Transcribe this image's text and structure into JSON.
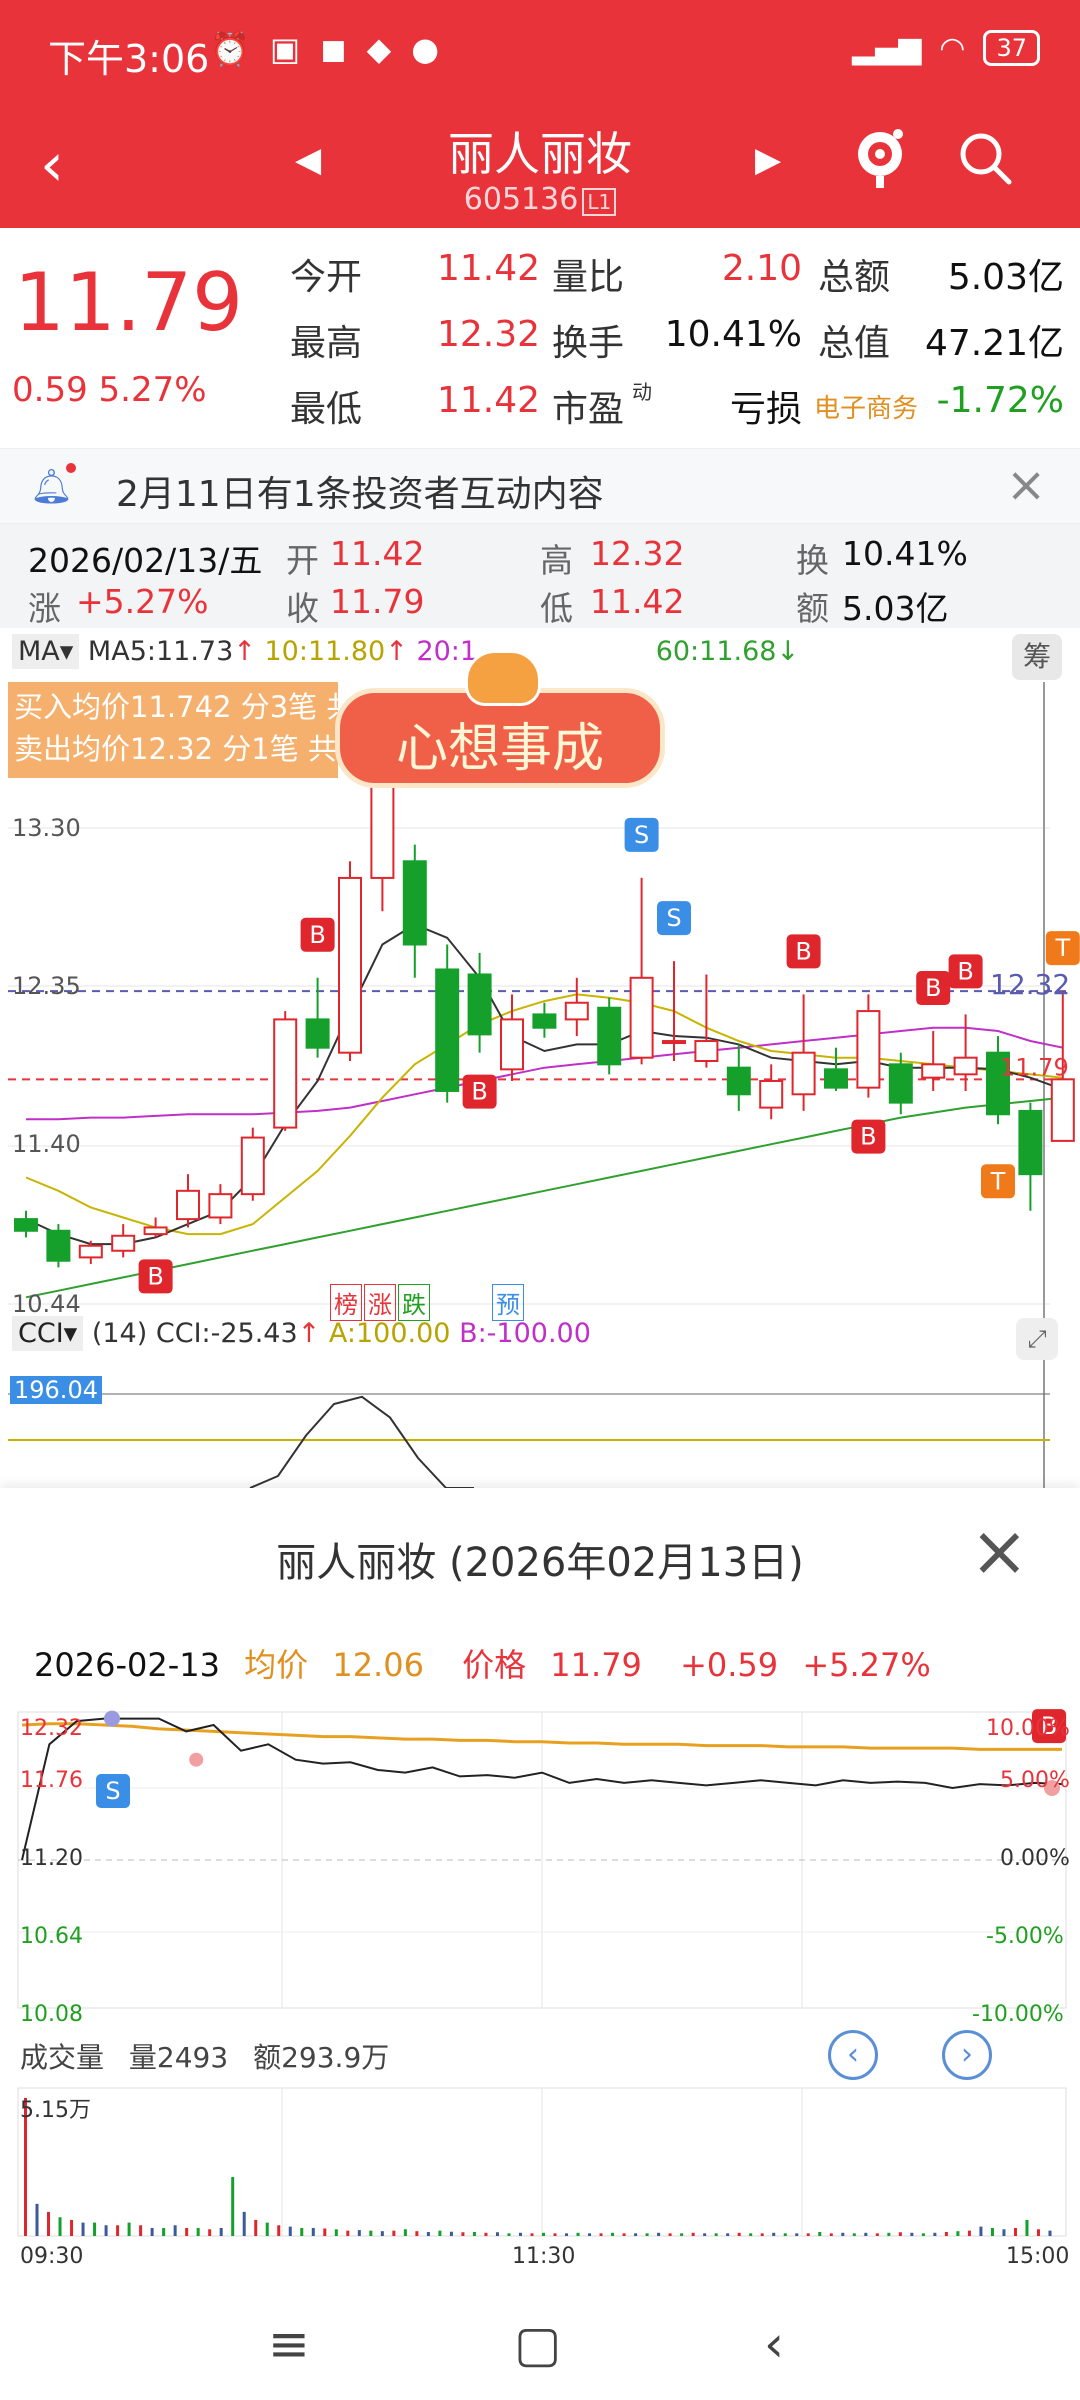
{
  "status_bar": {
    "time": "下午3:06",
    "icons_left": [
      "alarm-icon",
      "nfc-icon",
      "app-icon",
      "app-icon",
      "app-icon"
    ],
    "battery": "37"
  },
  "header": {
    "title": "丽人丽妆",
    "code": "605136",
    "code_badge": "L1"
  },
  "quote": {
    "price": "11.79",
    "change": "0.59",
    "change_pct": "5.27%",
    "fields": [
      {
        "label": "今开",
        "value": "11.42",
        "color": "#e8333a"
      },
      {
        "label": "量比",
        "value": "2.10",
        "color": "#e8333a"
      },
      {
        "label": "总额",
        "value": "5.03亿",
        "color": "#111111"
      },
      {
        "label": "最高",
        "value": "12.32",
        "color": "#e8333a"
      },
      {
        "label": "换手",
        "value": "10.41%",
        "color": "#111111"
      },
      {
        "label": "总值",
        "value": "47.21亿",
        "color": "#111111"
      },
      {
        "label": "最低",
        "value": "11.42",
        "color": "#e8333a"
      },
      {
        "label": "市盈",
        "value": "亏损",
        "color": "#111111"
      },
      {
        "label": "电子商务",
        "value": "-1.72%",
        "color": "#20a020"
      }
    ],
    "pe_superscript": "动"
  },
  "notice": {
    "text": "2月11日有1条投资者互动内容"
  },
  "kline_info": {
    "date": "2026/02/13/五",
    "open_label": "开",
    "open": "11.42",
    "high_label": "高",
    "high": "12.32",
    "turnover_label": "换",
    "turnover": "10.41%",
    "rise_label": "涨",
    "rise": "+5.27%",
    "close_label": "收",
    "close": "11.79",
    "low_label": "低",
    "low": "11.42",
    "amount_label": "额",
    "amount": "5.03亿"
  },
  "kline_chart": {
    "indicator": "MA",
    "ma5": "MA5:11.73",
    "ma10": "10:11.80",
    "ma20": "20:1",
    "ma60": "60:11.68",
    "chou_label": "筹",
    "buy_text": "买入均价11.742 分3笔 共",
    "sell_text": "卖出均价12.32 分1笔 共",
    "sticker_text": "心想事成",
    "y_ticks": [
      "13.30",
      "12.35",
      "11.40",
      "10.44"
    ],
    "price_line_label": "12.32",
    "current_label": "11.79",
    "tags": [
      "榜",
      "涨",
      "跌",
      "预"
    ],
    "cci_indicator": "CCI",
    "cci_params": "(14)",
    "cci_value": "CCI:-25.43",
    "cci_a": "A:100.00",
    "cci_b": "B:-100.00",
    "cci_top_label": "196.04",
    "candles": [
      {
        "o": 10.95,
        "c": 10.88,
        "h": 11.0,
        "l": 10.84
      },
      {
        "o": 10.88,
        "c": 10.7,
        "h": 10.92,
        "l": 10.66
      },
      {
        "o": 10.72,
        "c": 10.79,
        "h": 10.82,
        "l": 10.68
      },
      {
        "o": 10.76,
        "c": 10.85,
        "h": 10.92,
        "l": 10.72
      },
      {
        "o": 10.86,
        "c": 10.9,
        "h": 10.96,
        "l": 10.84
      },
      {
        "o": 10.95,
        "c": 11.12,
        "h": 11.22,
        "l": 10.9
      },
      {
        "o": 10.96,
        "c": 11.1,
        "h": 11.16,
        "l": 10.92
      },
      {
        "o": 11.1,
        "c": 11.44,
        "h": 11.5,
        "l": 11.06
      },
      {
        "o": 11.5,
        "c": 12.15,
        "h": 12.2,
        "l": 11.48
      },
      {
        "o": 12.15,
        "c": 11.98,
        "h": 12.4,
        "l": 11.92
      },
      {
        "o": 11.95,
        "c": 13.0,
        "h": 13.1,
        "l": 11.9
      },
      {
        "o": 13.0,
        "c": 13.62,
        "h": 13.7,
        "l": 12.8
      },
      {
        "o": 13.1,
        "c": 12.6,
        "h": 13.2,
        "l": 12.4
      },
      {
        "o": 12.45,
        "c": 11.72,
        "h": 12.6,
        "l": 11.65
      },
      {
        "o": 12.42,
        "c": 12.06,
        "h": 12.55,
        "l": 11.95
      },
      {
        "o": 11.85,
        "c": 12.15,
        "h": 12.3,
        "l": 11.78
      },
      {
        "o": 12.18,
        "c": 12.1,
        "h": 12.25,
        "l": 12.04
      },
      {
        "o": 12.15,
        "c": 12.25,
        "h": 12.4,
        "l": 12.05
      },
      {
        "o": 12.22,
        "c": 11.88,
        "h": 12.28,
        "l": 11.82
      },
      {
        "o": 11.92,
        "c": 12.4,
        "h": 13.0,
        "l": 11.88
      },
      {
        "o": 12.02,
        "c": 12.02,
        "h": 12.5,
        "l": 11.9
      },
      {
        "o": 11.9,
        "c": 12.02,
        "h": 12.42,
        "l": 11.86
      },
      {
        "o": 11.86,
        "c": 11.7,
        "h": 12.0,
        "l": 11.6
      },
      {
        "o": 11.62,
        "c": 11.78,
        "h": 11.88,
        "l": 11.55
      },
      {
        "o": 11.7,
        "c": 11.95,
        "h": 12.3,
        "l": 11.6
      },
      {
        "o": 11.85,
        "c": 11.74,
        "h": 11.98,
        "l": 11.72
      },
      {
        "o": 11.74,
        "c": 12.2,
        "h": 12.3,
        "l": 11.68
      },
      {
        "o": 11.88,
        "c": 11.65,
        "h": 11.95,
        "l": 11.58
      },
      {
        "o": 11.8,
        "c": 11.88,
        "h": 12.08,
        "l": 11.72
      },
      {
        "o": 11.82,
        "c": 11.92,
        "h": 12.18,
        "l": 11.72
      },
      {
        "o": 11.95,
        "c": 11.58,
        "h": 12.05,
        "l": 11.52
      },
      {
        "o": 11.6,
        "c": 11.22,
        "h": 11.65,
        "l": 11.0
      },
      {
        "o": 11.42,
        "c": 11.79,
        "h": 12.32,
        "l": 11.42
      }
    ],
    "ma5_line": [
      10.95,
      10.86,
      10.8,
      10.8,
      10.84,
      10.92,
      11.0,
      11.2,
      11.52,
      11.78,
      12.2,
      12.6,
      12.72,
      12.64,
      12.4,
      12.05,
      11.96,
      12.0,
      12.0,
      12.08,
      12.05,
      12.04,
      12.0,
      11.92,
      11.9,
      11.88,
      11.9,
      11.86,
      11.86,
      11.86,
      11.85,
      11.8,
      11.73
    ],
    "ma10_line": [
      11.2,
      11.12,
      11.02,
      10.96,
      10.9,
      10.86,
      10.86,
      10.92,
      11.08,
      11.24,
      11.45,
      11.68,
      11.88,
      12.0,
      12.12,
      12.2,
      12.26,
      12.3,
      12.28,
      12.25,
      12.2,
      12.1,
      12.02,
      11.96,
      11.94,
      11.92,
      11.92,
      11.9,
      11.88,
      11.86,
      11.84,
      11.82,
      11.8
    ],
    "ma20_line": [
      11.55,
      11.55,
      11.56,
      11.56,
      11.57,
      11.58,
      11.58,
      11.58,
      11.59,
      11.6,
      11.62,
      11.66,
      11.7,
      11.74,
      11.78,
      11.82,
      11.86,
      11.88,
      11.9,
      11.92,
      11.94,
      11.96,
      11.98,
      12.0,
      12.02,
      12.04,
      12.06,
      12.08,
      12.1,
      12.1,
      12.08,
      12.02,
      11.98
    ],
    "ma60_line": [
      10.48,
      10.52,
      10.56,
      10.6,
      10.64,
      10.68,
      10.72,
      10.76,
      10.8,
      10.84,
      10.88,
      10.92,
      10.96,
      11.0,
      11.04,
      11.08,
      11.12,
      11.16,
      11.2,
      11.24,
      11.28,
      11.32,
      11.36,
      11.4,
      11.44,
      11.48,
      11.52,
      11.56,
      11.59,
      11.62,
      11.64,
      11.66,
      11.68
    ],
    "cci_line": [
      -40,
      20,
      110,
      180,
      196,
      150,
      60,
      -10,
      -20
    ],
    "markers": [
      {
        "type": "b",
        "label": "B",
        "idx": 4
      },
      {
        "type": "b",
        "label": "B",
        "idx": 9
      },
      {
        "type": "s",
        "label": "S",
        "idx": 11
      },
      {
        "type": "b",
        "label": "B",
        "idx": 14
      },
      {
        "type": "s",
        "label": "S",
        "idx": 19
      },
      {
        "type": "s",
        "label": "S",
        "idx": 20
      },
      {
        "type": "b",
        "label": "B",
        "idx": 24
      },
      {
        "type": "b",
        "label": "B",
        "idx": 26
      },
      {
        "type": "b",
        "label": "B",
        "idx": 28
      },
      {
        "type": "b",
        "label": "B",
        "idx": 29
      },
      {
        "type": "t",
        "label": "T",
        "idx": 30
      },
      {
        "type": "t",
        "label": "T",
        "idx": 32
      }
    ]
  },
  "intraday": {
    "title": "丽人丽妆 (2026年02月13日)",
    "date": "2026-02-13",
    "avg_label": "均价",
    "avg": "12.06",
    "price_label": "价格",
    "price": "11.79",
    "change": "+0.59",
    "change_pct": "+5.27%",
    "y_left": [
      "12.32",
      "11.76",
      "11.20",
      "10.64",
      "10.08"
    ],
    "y_right": [
      "10.00%",
      "5.00%",
      "0.00%",
      "-5.00%",
      "-10.00%"
    ],
    "volume_label": "成交量",
    "volume": "量2493",
    "amount": "额293.9万",
    "vol_max_label": "5.15万",
    "x_labels": [
      "09:30",
      "11:30",
      "15:00"
    ],
    "price_series": [
      11.2,
      12.1,
      12.28,
      12.3,
      12.3,
      12.3,
      12.2,
      12.25,
      12.05,
      12.1,
      11.98,
      11.95,
      11.96,
      11.9,
      11.88,
      11.92,
      11.85,
      11.86,
      11.84,
      11.88,
      11.8,
      11.83,
      11.8,
      11.82,
      11.8,
      11.78,
      11.8,
      11.82,
      11.8,
      11.78,
      11.82,
      11.8,
      11.81,
      11.8,
      11.76,
      11.79,
      11.78,
      11.8,
      11.79
    ],
    "avg_series": [
      12.25,
      12.26,
      12.26,
      12.25,
      12.24,
      12.22,
      12.21,
      12.2,
      12.19,
      12.18,
      12.17,
      12.16,
      12.16,
      12.15,
      12.14,
      12.14,
      12.13,
      12.13,
      12.12,
      12.12,
      12.11,
      12.11,
      12.1,
      12.1,
      12.1,
      12.09,
      12.09,
      12.09,
      12.08,
      12.08,
      12.08,
      12.07,
      12.07,
      12.07,
      12.07,
      12.06,
      12.06,
      12.06,
      12.06
    ],
    "volumes": [
      5.15,
      1.2,
      0.9,
      0.7,
      0.6,
      0.5,
      0.5,
      0.4,
      0.4,
      0.5,
      0.4,
      0.3,
      0.3,
      0.4,
      0.3,
      0.3,
      0.25,
      0.3,
      2.2,
      0.9,
      0.6,
      0.5,
      0.4,
      0.35,
      0.3,
      0.3,
      0.28,
      0.25,
      0.2,
      0.22,
      0.2,
      0.18,
      0.2,
      0.25,
      0.18,
      0.15,
      0.2,
      0.16,
      0.14,
      0.15,
      0.12,
      0.14,
      0.1,
      0.12,
      0.1,
      0.12,
      0.1,
      0.1,
      0.12,
      0.1,
      0.1,
      0.12,
      0.1,
      0.1,
      0.1,
      0.12,
      0.1,
      0.1,
      0.12,
      0.1,
      0.1,
      0.1,
      0.12,
      0.1,
      0.1,
      0.12,
      0.1,
      0.1,
      0.1,
      0.15,
      0.1,
      0.12,
      0.1,
      0.12,
      0.1,
      0.12,
      0.14,
      0.12,
      0.1,
      0.12,
      0.15,
      0.18,
      0.2,
      0.35,
      0.3,
      0.25,
      0.3,
      0.6,
      0.25,
      0.2
    ]
  },
  "colors": {
    "up": "#e0262d",
    "down": "#14a02a",
    "ma5": "#333333",
    "ma10": "#c8b400",
    "ma20": "#c030c8",
    "ma60": "#30a030",
    "avg": "#e8a020",
    "header": "#e8333a"
  }
}
